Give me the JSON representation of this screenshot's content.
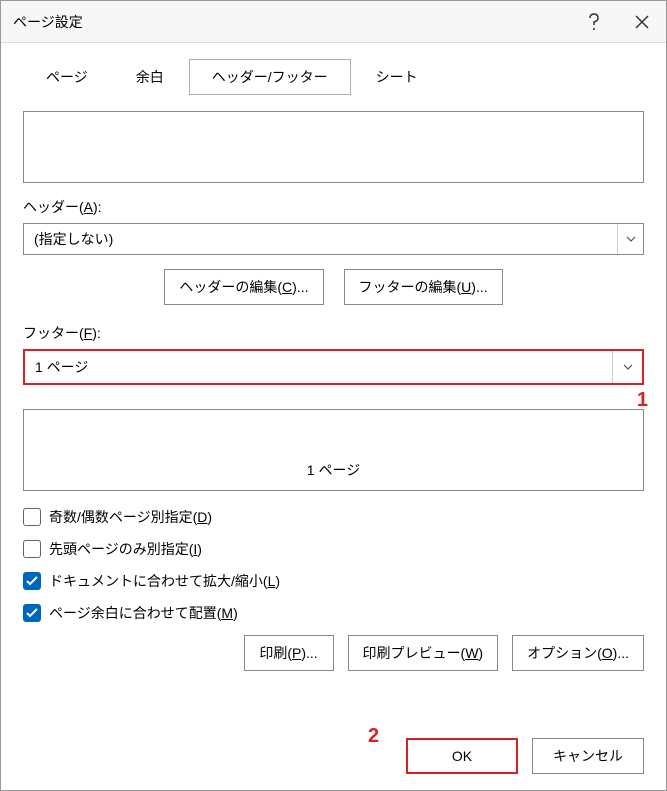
{
  "title": "ページ設定",
  "tabs": {
    "page": "ページ",
    "margins": "余白",
    "header_footer": "ヘッダー/フッター",
    "sheet": "シート"
  },
  "header": {
    "label_prefix": "ヘッダー(",
    "label_key": "A",
    "label_suffix": "):",
    "value": "(指定しない)"
  },
  "edit_buttons": {
    "header_prefix": "ヘッダーの編集(",
    "header_key": "C",
    "header_suffix": ")...",
    "footer_prefix": "フッターの編集(",
    "footer_key": "U",
    "footer_suffix": ")..."
  },
  "footer": {
    "label_prefix": "フッター(",
    "label_key": "F",
    "label_suffix": "):",
    "value": "1 ページ",
    "preview": "1 ページ"
  },
  "checkboxes": {
    "odd_even": {
      "prefix": "奇数/偶数ページ別指定(",
      "key": "D",
      "suffix": ")",
      "checked": false
    },
    "first_page": {
      "prefix": "先頭ページのみ別指定(",
      "key": "I",
      "suffix": ")",
      "checked": false
    },
    "scale": {
      "prefix": "ドキュメントに合わせて拡大/縮小(",
      "key": "L",
      "suffix": ")",
      "checked": true
    },
    "align_margin": {
      "prefix": "ページ余白に合わせて配置(",
      "key": "M",
      "suffix": ")",
      "checked": true
    }
  },
  "lower_buttons": {
    "print_prefix": "印刷(",
    "print_key": "P",
    "print_suffix": ")...",
    "preview_prefix": "印刷プレビュー(",
    "preview_key": "W",
    "preview_suffix": ")",
    "options_prefix": "オプション(",
    "options_key": "O",
    "options_suffix": ")..."
  },
  "dialog_buttons": {
    "ok": "OK",
    "cancel": "キャンセル"
  },
  "annotations": {
    "one": "1",
    "two": "2"
  }
}
